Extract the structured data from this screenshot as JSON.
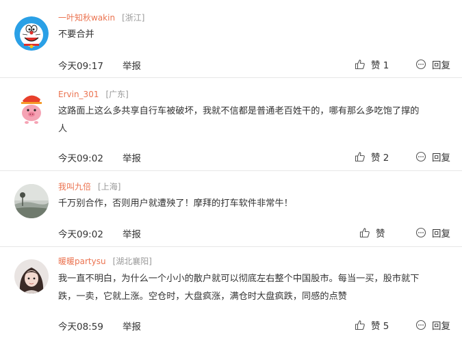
{
  "like_label": "赞",
  "reply_label": "回复",
  "report_label": "举报",
  "colors": {
    "username": "#eb7350",
    "location": "#999999",
    "text": "#333333",
    "separator": "#e6e6e6"
  },
  "comments": [
    {
      "username": "一叶知秋wakin",
      "location": "[浙江]",
      "avatar_icon": "doraemon-avatar-icon",
      "text": "不要合并",
      "time": "今天09:17",
      "likes": "1"
    },
    {
      "username": "Ervin_301",
      "location": "[广东]",
      "avatar_icon": "pig-avatar-icon",
      "text": "这路面上这么多共享自行车被破坏，我就不信都是普通老百姓干的，哪有那么多吃饱了撑的\n人",
      "time": "今天09:02",
      "likes": "2"
    },
    {
      "username": "我叫九倍",
      "location": "[上海]",
      "avatar_icon": "landscape-avatar-icon",
      "text": "千万别合作，否则用户就遭殃了！摩拜的打车软件非常牛！",
      "time": "今天09:02",
      "likes": ""
    },
    {
      "username": "暖暖partysu",
      "location": "[湖北襄阳]",
      "avatar_icon": "girl-portrait-avatar-icon",
      "text": "我一直不明白，为什么一个小小的散户就可以彻底左右整个中国股市。每当一买，股市就下\n跌，一卖，它就上涨。空仓时，大盘疯涨，满仓时大盘疯跌，同感的点赞",
      "time": "今天08:59",
      "likes": "5"
    }
  ]
}
